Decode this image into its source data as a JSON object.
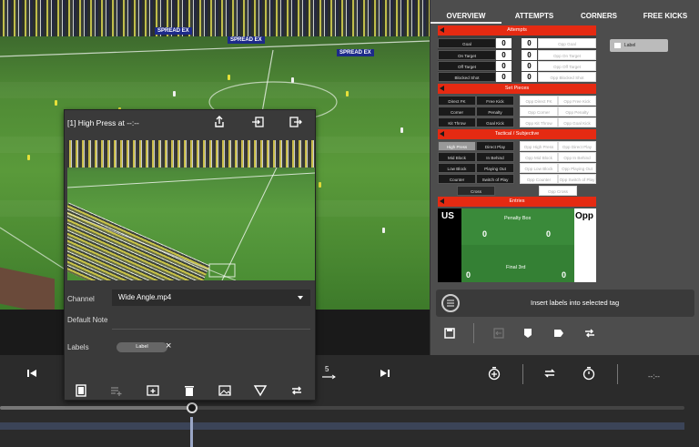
{
  "video": {
    "banners": [
      "SPREAD EX",
      "SPREAD EX",
      "SPREAD EX"
    ]
  },
  "panel": {
    "tabs": [
      "OVERVIEW",
      "ATTEMPTS",
      "CORNERS",
      "FREE KICKS"
    ],
    "active_tab": "OVERVIEW",
    "attempts": {
      "title": "Attempts",
      "rows": [
        {
          "label": "Goal",
          "us": "0",
          "opp": "0",
          "opp_label": "Opp Goal"
        },
        {
          "label": "On Target",
          "us": "0",
          "opp": "0",
          "opp_label": "Opp On Target"
        },
        {
          "label": "Off Target",
          "us": "0",
          "opp": "0",
          "opp_label": "Opp Off Target"
        },
        {
          "label": "Blocked Shot",
          "us": "0",
          "opp": "0",
          "opp_label": "Opp Blocked Shot"
        }
      ]
    },
    "set_pieces": {
      "title": "Set Pieces",
      "us": [
        "Direct FK",
        "Free Kick",
        "Corner",
        "Penalty",
        "Kit Throw",
        "Goal Kick"
      ],
      "opp": [
        "Opp Direct FK",
        "Opp Free Kick",
        "Opp Corner",
        "Opp Penalty",
        "Opp Kit Throw",
        "Opp Goal Kick"
      ]
    },
    "tactical": {
      "title": "Tactical / Subjective",
      "us": [
        "High Press",
        "Direct Play",
        "Mid Block",
        "In Behind",
        "Low Block",
        "Playing Out",
        "Counter",
        "Switch of Play"
      ],
      "opp": [
        "Opp High Press",
        "Opp Direct Play",
        "Opp Mid Block",
        "Opp In Behind",
        "Opp Low Block",
        "Opp Playing Out",
        "Opp Counter",
        "Opp Switch of Play"
      ],
      "extra_us": "Cross",
      "extra_opp": "Opp Cross",
      "selected": "High Press"
    },
    "entries": {
      "title": "Entries",
      "us_label": "US",
      "opp_label": "Opp",
      "penalty_box": "Penalty Box",
      "final_third": "Final 3rd",
      "pb_left": "0",
      "pb_right": "0",
      "f3_left": "0",
      "f3_right": "0"
    },
    "label_chip": "Label",
    "insert_text": "Insert labels into selected tag",
    "tools": [
      "save-icon",
      "insert-icon",
      "tag-shield-icon",
      "tag-icon",
      "split-icon"
    ]
  },
  "popup": {
    "title": "[1] High Press at --:--",
    "channel_label": "Channel",
    "channel_value": "Wide Angle.mp4",
    "note_label": "Default Note",
    "labels_label": "Labels",
    "label_chip": "Label",
    "remove": "×"
  },
  "transport": {
    "time": "--:--",
    "step_label": "5"
  },
  "scrub": {
    "position": 0.28
  }
}
